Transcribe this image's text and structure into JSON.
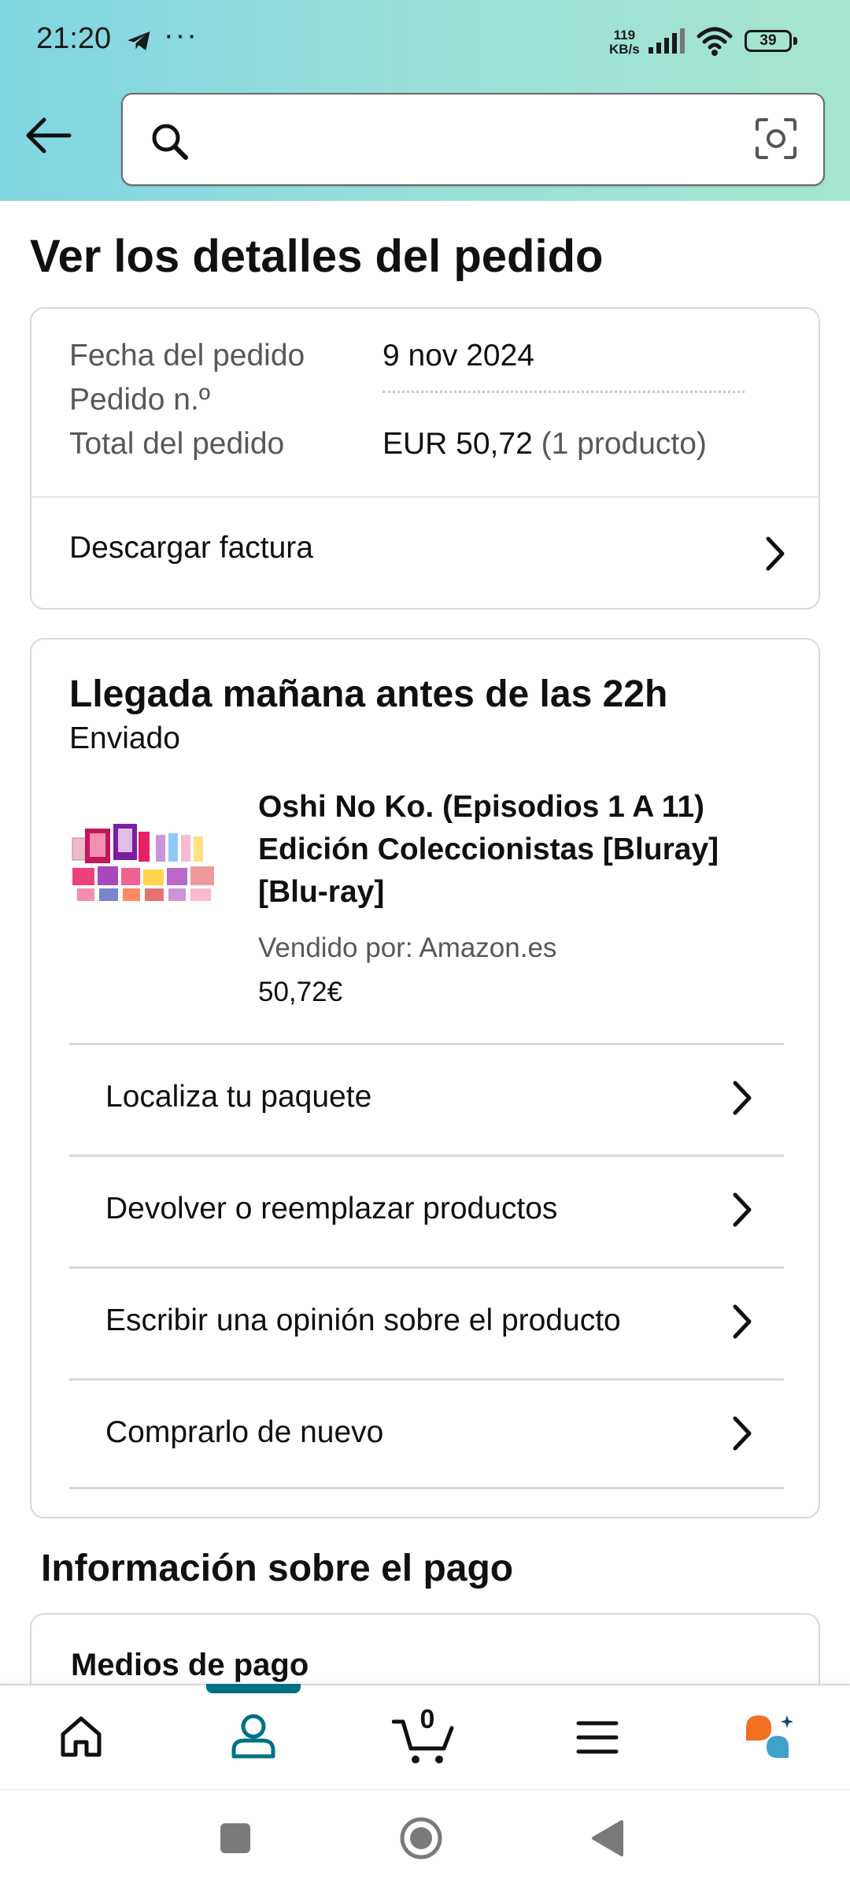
{
  "status_bar": {
    "time": "21:20",
    "dots": "···",
    "speed_value": "119",
    "speed_unit": "KB/s",
    "battery": "39"
  },
  "header": {
    "search_placeholder": ""
  },
  "page": {
    "title": "Ver los detalles del pedido"
  },
  "order_summary": {
    "date_label": "Fecha del pedido",
    "date_value": "9 nov 2024",
    "number_label": "Pedido n.º",
    "total_label": "Total del pedido",
    "total_value": "EUR 50,72",
    "total_items": "(1 producto)",
    "invoice_label": "Descargar factura"
  },
  "shipment": {
    "status": "Llegada mañana antes de las 22h",
    "substatus": "Enviado",
    "product": {
      "title": "Oshi No Ko. (Episodios 1 A 11) Edición Coleccionistas [Bluray] [Blu-ray]",
      "seller": "Vendido por: Amazon.es",
      "price": "50,72€"
    },
    "actions": [
      {
        "label": "Localiza tu paquete"
      },
      {
        "label": "Devolver o reemplazar productos"
      },
      {
        "label": "Escribir una opinión sobre el producto"
      },
      {
        "label": "Comprarlo de nuevo"
      }
    ]
  },
  "payment": {
    "section_title": "Información sobre el pago",
    "methods_label": "Medios de pago"
  },
  "bottom_nav": {
    "active": "account",
    "cart_count": "0",
    "accent_color": "#007185",
    "ai_color": "#f26f22"
  }
}
